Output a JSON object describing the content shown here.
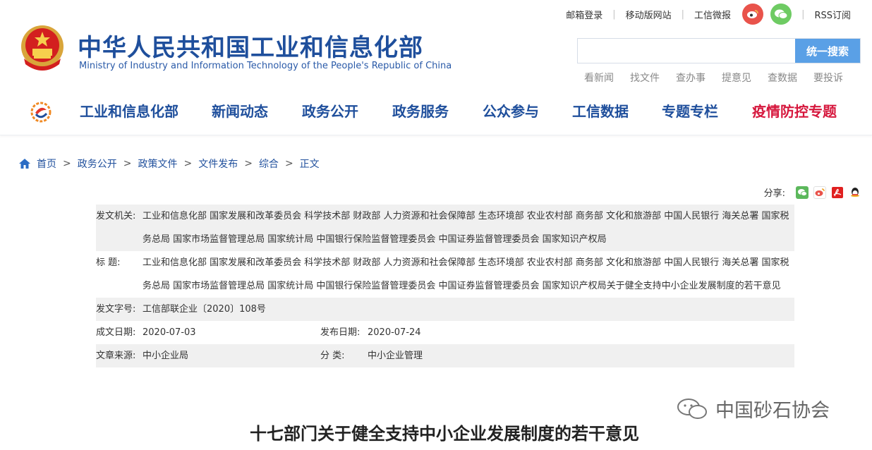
{
  "header": {
    "title_cn": "中华人民共和国工业和信息化部",
    "title_en": "Ministry of Industry and Information Technology of the People's Republic of China",
    "top_links": [
      "邮箱登录",
      "移动版网站",
      "工信微报",
      "RSS订阅"
    ],
    "search": {
      "placeholder": "",
      "button": "统一搜索"
    },
    "quick_links": [
      "看新闻",
      "找文件",
      "查办事",
      "提意见",
      "查数据",
      "要投诉"
    ]
  },
  "nav": {
    "items": [
      "工业和信息化部",
      "新闻动态",
      "政务公开",
      "政务服务",
      "公众参与",
      "工信数据",
      "专题专栏",
      "疫情防控专题"
    ]
  },
  "breadcrumb": [
    "首页",
    "政务公开",
    "政策文件",
    "文件发布",
    "综合",
    "正文"
  ],
  "share": {
    "label": "分享:"
  },
  "info": {
    "issuer_label": "发文机关:",
    "issuer": "工业和信息化部 国家发展和改革委员会 科学技术部 财政部 人力资源和社会保障部 生态环境部 农业农村部 商务部 文化和旅游部 中国人民银行 海关总署 国家税务总局 国家市场监督管理总局 国家统计局 中国银行保险监督管理委员会 中国证券监督管理委员会 国家知识产权局",
    "title_label": "标 题:",
    "title": "工业和信息化部 国家发展和改革委员会 科学技术部 财政部 人力资源和社会保障部 生态环境部 农业农村部 商务部 文化和旅游部 中国人民银行 海关总署 国家税务总局 国家市场监督管理总局 国家统计局 中国银行保险监督管理委员会 中国证券监督管理委员会 国家知识产权局关于健全支持中小企业发展制度的若干意见",
    "doc_no_label": "发文字号:",
    "doc_no": "工信部联企业〔2020〕108号",
    "created_label": "成文日期:",
    "created": "2020-07-03",
    "published_label": "发布日期:",
    "published": "2020-07-24",
    "source_label": "文章来源:",
    "source": "中小企业局",
    "category_label": "分 类:",
    "category": "中小企业管理"
  },
  "watermark": "中国砂石协会",
  "doc_title": "十七部门关于健全支持中小企业发展制度的若干意见",
  "colors": {
    "brand_blue": "#1f4f9c",
    "special_red": "#d6173d",
    "search_button": "#5aa0e6"
  }
}
